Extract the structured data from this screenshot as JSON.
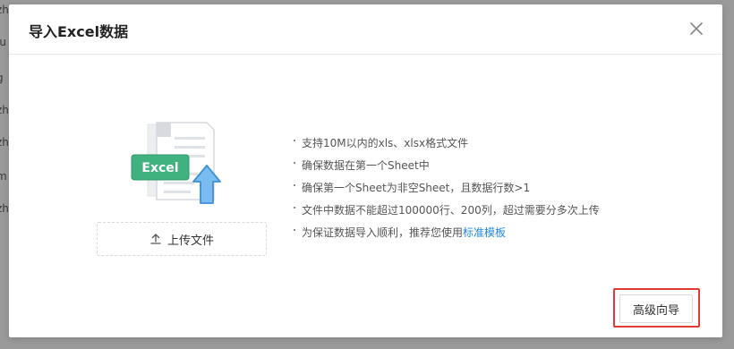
{
  "background": {
    "fragments": [
      "zh",
      "iu",
      "g",
      "zh",
      "zh",
      "m",
      "zh"
    ]
  },
  "modal": {
    "title": "导入Excel数据",
    "close_icon": "close-icon",
    "illustration": {
      "badge_text": "Excel",
      "badge_color": "#3fb27f",
      "arrow_color": "#5aa7e8"
    },
    "upload_button": {
      "icon": "upload-icon",
      "label": "上传文件"
    },
    "tips": {
      "line1": "支持10M以内的xls、xlsx格式文件",
      "line2": "确保数据在第一个Sheet中",
      "line3": "确保第一个Sheet为非空Sheet，且数据行数>1",
      "line4": "文件中数据不能超过100000行、200列，超过需要分多次上传",
      "line5_prefix": "为保证数据导入顺利，推荐您使用",
      "line5_link": "标准模板"
    },
    "advanced_button": {
      "label": "高级向导",
      "highlight_color": "#e53935"
    }
  }
}
